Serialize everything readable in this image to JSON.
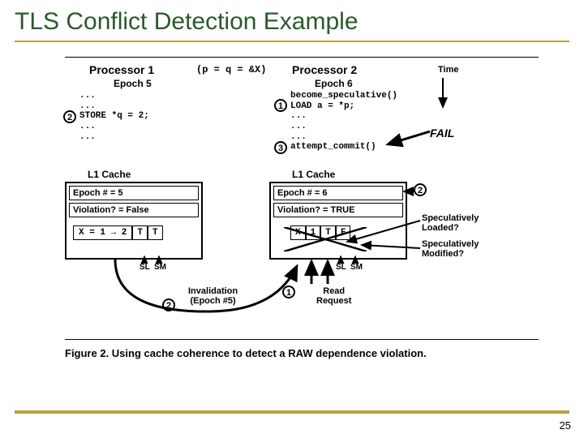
{
  "title": "TLS Conflict Detection Example",
  "page_number": "25",
  "shared": "(p = q = &X)",
  "time_label": "Time",
  "fail_label": "FAIL",
  "proc1": {
    "header": "Processor 1",
    "epoch": "Epoch 5",
    "code": "...\n...\nSTORE *q = 2;\n...\n..."
  },
  "proc2": {
    "header": "Processor 2",
    "epoch": "Epoch 6",
    "code": "become_speculative()\nLOAD a = *p;\n...\n...\n...\nattempt_commit()"
  },
  "cache1": {
    "title": "L1 Cache",
    "epoch": "Epoch # = 5",
    "violation": "Violation? = False",
    "entry_x": "X = 1 → 2",
    "entry_sl": "T",
    "entry_sm": "T",
    "sl_label": "SL",
    "sm_label": "SM"
  },
  "cache2": {
    "title": "L1 Cache",
    "epoch": "Epoch # = 6",
    "violation": "Violation? = TRUE",
    "entry_x": "X",
    "entry_v": "1",
    "entry_sl": "T",
    "entry_sm": "F",
    "sl_label": "SL",
    "sm_label": "SM"
  },
  "annotations": {
    "spec_loaded": "Speculatively\nLoaded?",
    "spec_modified": "Speculatively\nModified?",
    "invalidation": "Invalidation\n(Epoch #5)",
    "read_request": "Read\nRequest"
  },
  "caption": "Figure 2. Using cache coherence to detect a RAW dependence violation.",
  "markers": {
    "m1": "1",
    "m2": "2",
    "m3": "3"
  }
}
